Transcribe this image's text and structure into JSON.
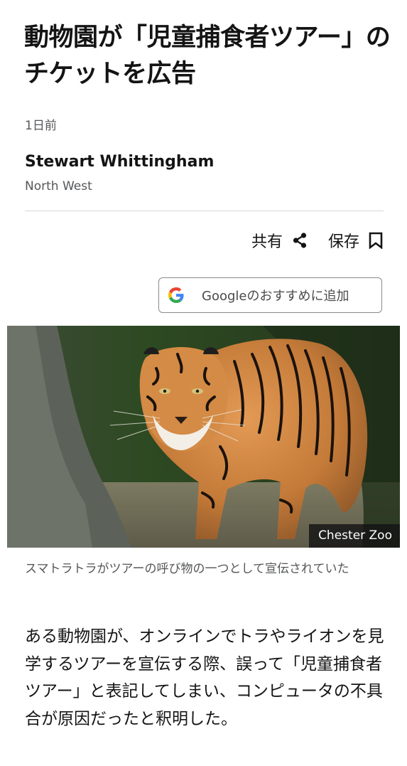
{
  "article": {
    "headline": "動物園が「児童捕食者ツアー」のチケットを広告",
    "timestamp": "1日前",
    "author": "Stewart Whittingham",
    "region": "North West"
  },
  "actions": {
    "share_label": "共有",
    "save_label": "保存",
    "share_icon": "share-icon",
    "save_icon": "bookmark-icon"
  },
  "google_button": {
    "label": "Googleのおすすめに追加",
    "icon": "google-g-icon"
  },
  "image": {
    "subject": "tiger",
    "credit": "Chester Zoo",
    "caption": "スマトラトラがツアーの呼び物の一つとして宣伝されていた"
  },
  "body": {
    "paragraph": "ある動物園が、オンラインでトラやライオンを見学するツアーを宣伝する際、誤って「児童捕食者ツアー」と表記してしまい、コンピュータの不具合が原因だったと釈明した。"
  },
  "colors": {
    "text": "#141414",
    "secondary_text": "#545658",
    "divider": "#d7d7d7",
    "button_border": "#8a8a8a",
    "credit_bg": "#141414"
  }
}
